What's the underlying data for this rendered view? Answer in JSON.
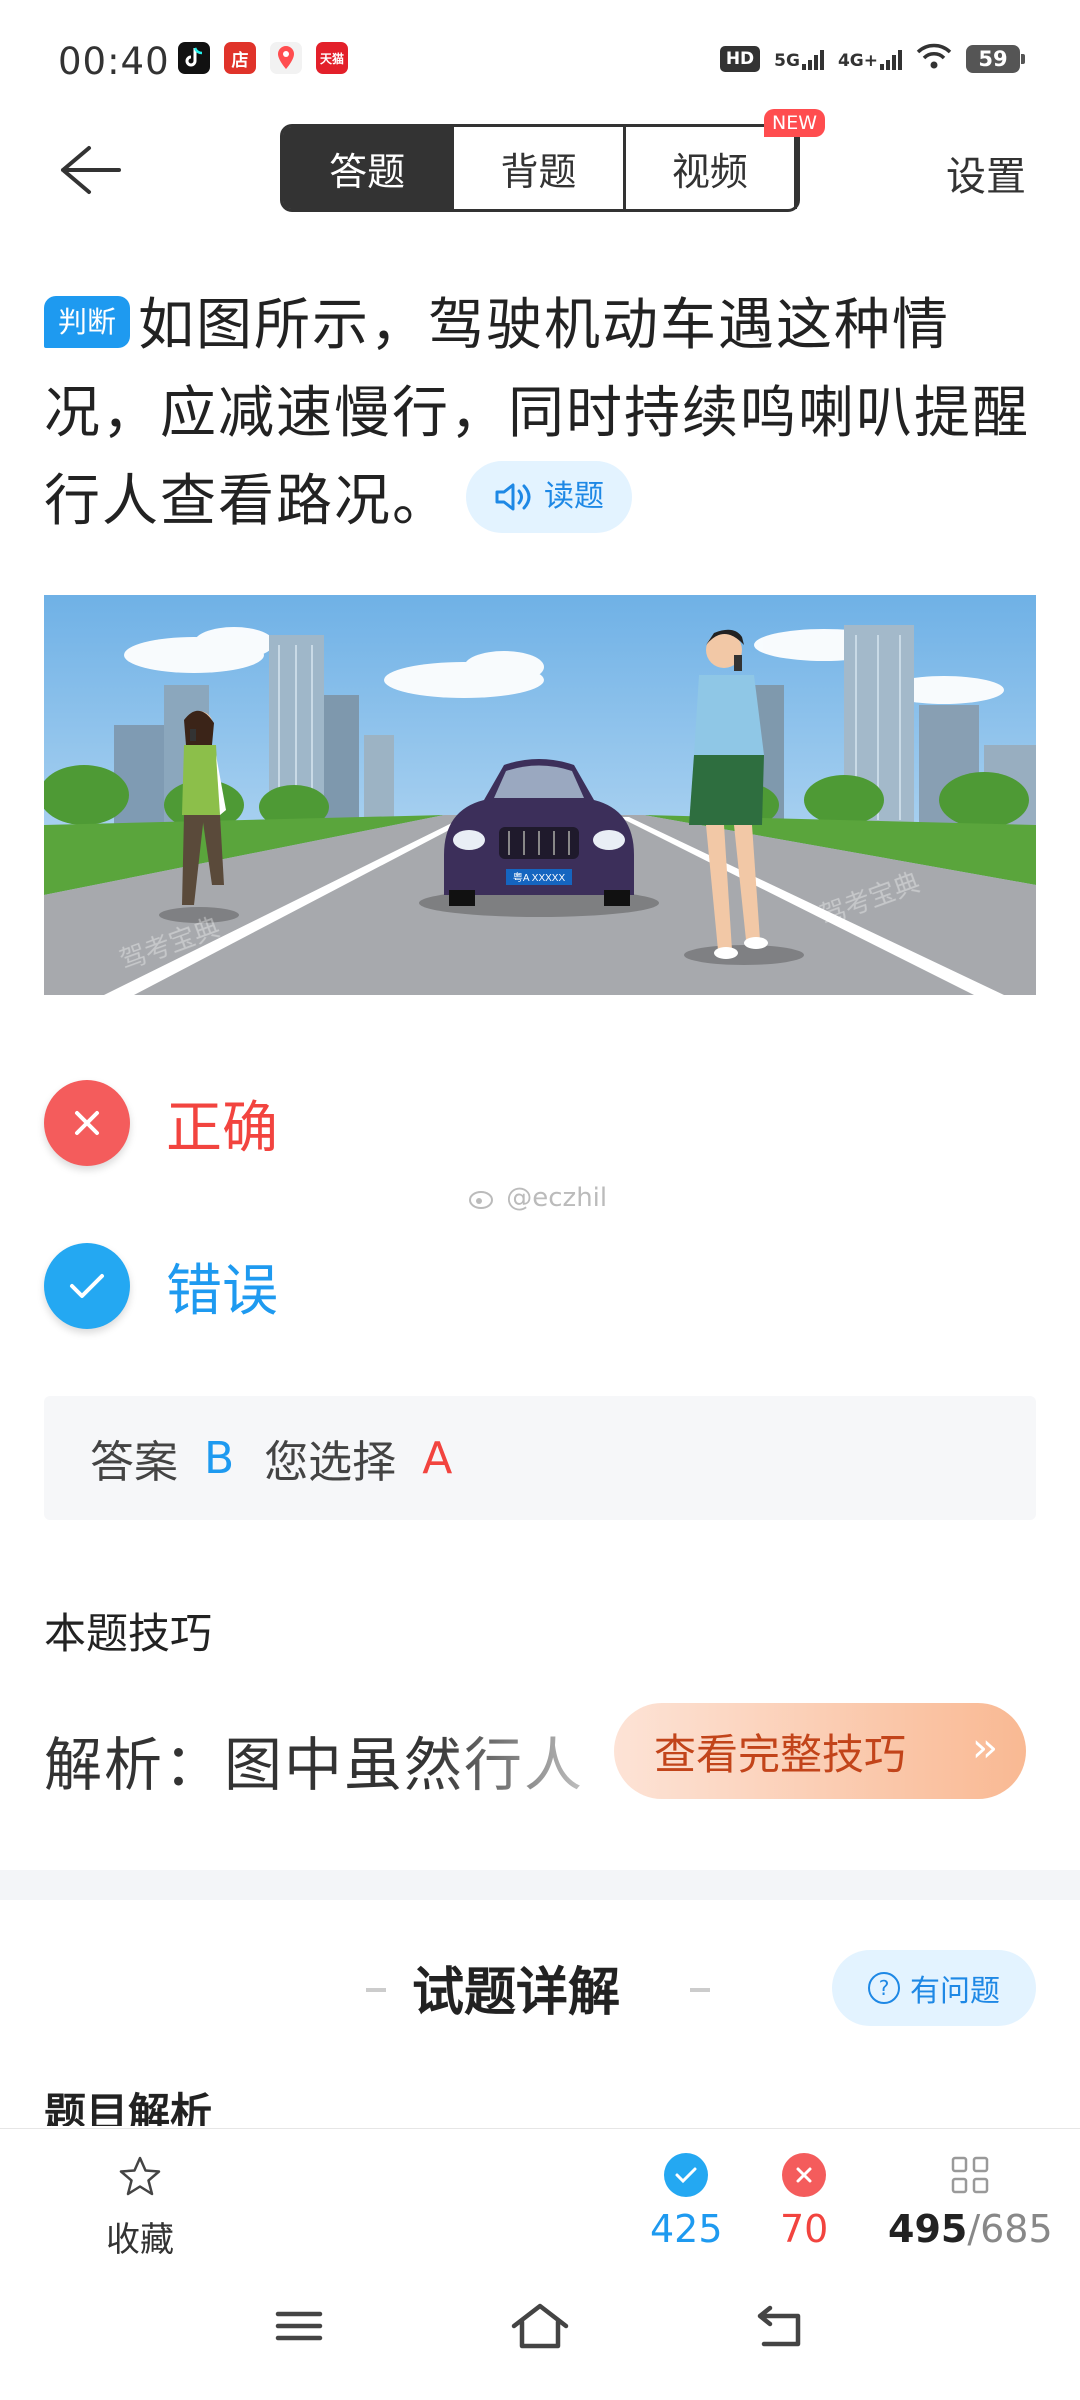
{
  "status_bar": {
    "time": "00:40",
    "app_icons": [
      {
        "name": "tiktok",
        "glyph": "♪",
        "color": "#111111"
      },
      {
        "name": "shop",
        "glyph": "店",
        "color": "#e0332a"
      },
      {
        "name": "map-pin",
        "glyph": "•",
        "color": "#ffffff"
      },
      {
        "name": "tmall",
        "glyph": "天猫",
        "color": "#e3202a"
      }
    ],
    "hd": "HD",
    "net1": "5G",
    "net2": "4G+",
    "battery": "59"
  },
  "header": {
    "tabs": [
      {
        "label": "答题",
        "active": true
      },
      {
        "label": "背题",
        "active": false
      },
      {
        "label": "视频",
        "active": false
      }
    ],
    "new_badge": "NEW",
    "settings": "设置"
  },
  "question": {
    "type_badge": "判断",
    "text": "如图所示，驾驶机动车遇这种情况，应减速慢行，同时持续鸣喇叭提醒行人查看路况。",
    "read_button": "读题"
  },
  "scene": {
    "plate": "粤A XXXXX",
    "watermark": "驾考宝典"
  },
  "options": [
    {
      "label": "正确",
      "state": "wrong-chosen"
    },
    {
      "label": "错误",
      "state": "correct"
    }
  ],
  "watermark": "@eczhil",
  "answer": {
    "answer_label": "答案",
    "answer_value": "B",
    "chosen_label": "您选择",
    "chosen_value": "A"
  },
  "tips": {
    "title": "本题技巧",
    "text": "解析：图中虽然行人",
    "button": "查看完整技巧"
  },
  "detail": {
    "title": "试题详解",
    "ask_button": "有问题",
    "section": "题目解析"
  },
  "bottom": {
    "favorite": "收藏",
    "right_count": "425",
    "wrong_count": "70",
    "done": "495",
    "total": "/685"
  },
  "colors": {
    "blue": "#1e9af0",
    "red": "#f2443f",
    "dark": "#333333"
  }
}
